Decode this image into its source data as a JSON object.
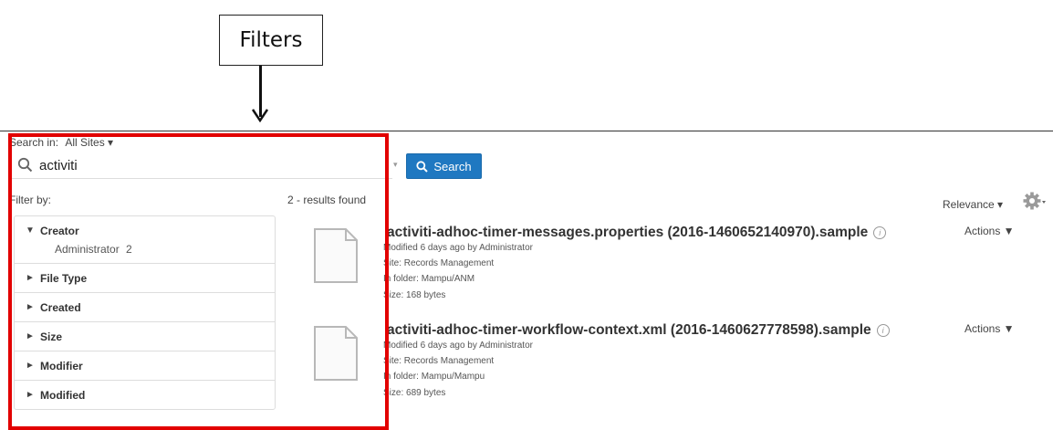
{
  "callout": {
    "label": "Filters"
  },
  "search": {
    "search_in_label": "Search in:",
    "site_selector": "All Sites ▾",
    "query": "activiti",
    "button_label": "Search"
  },
  "filters": {
    "heading": "Filter by:",
    "facets": [
      {
        "label": "Creator",
        "expanded": true,
        "options": [
          {
            "label": "Administrator",
            "count": "2"
          }
        ]
      },
      {
        "label": "File Type",
        "expanded": false
      },
      {
        "label": "Created",
        "expanded": false
      },
      {
        "label": "Size",
        "expanded": false
      },
      {
        "label": "Modifier",
        "expanded": false
      },
      {
        "label": "Modified",
        "expanded": false
      }
    ]
  },
  "results": {
    "summary": "2 - results found",
    "sort_label": "Relevance ▾",
    "items": [
      {
        "title": "activiti-adhoc-timer-messages.properties (2016-1460652140970).sample",
        "modified": "Modified 6 days ago by Administrator",
        "site": "Site: Records Management",
        "folder": "In folder: Mampu/ANM",
        "size": "Size: 168 bytes",
        "actions": "Actions ▼"
      },
      {
        "title": "activiti-adhoc-timer-workflow-context.xml (2016-1460627778598).sample",
        "modified": "Modified 6 days ago by Administrator",
        "site": "Site: Records Management",
        "folder": "In folder: Mampu/Mampu",
        "size": "Size: 689 bytes",
        "actions": "Actions ▼"
      }
    ]
  },
  "colors": {
    "highlight_frame": "#e20000",
    "primary_button": "#1f78c1"
  }
}
